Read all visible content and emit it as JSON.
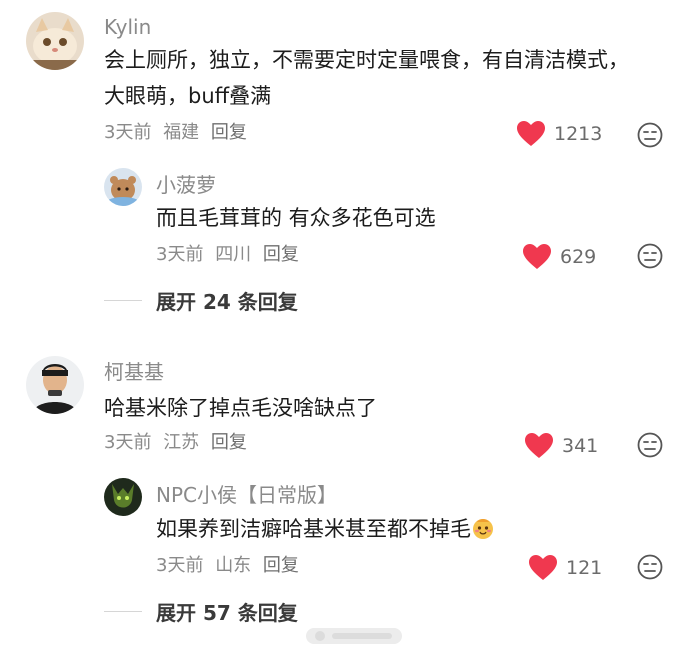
{
  "comments": [
    {
      "user": "Kylin",
      "text": "会上厕所，独立，不需要定时定量喂食，有自清洁模式，大眼萌，buff叠满",
      "time": "3天前",
      "location": "福建",
      "reply_label": "回复",
      "likes": "1213",
      "replies": [
        {
          "user": "小菠萝",
          "text": "而且毛茸茸的 有众多花色可选",
          "time": "3天前",
          "location": "四川",
          "reply_label": "回复",
          "likes": "629"
        }
      ],
      "expand_label": "展开 24 条回复"
    },
    {
      "user": "柯基基",
      "text": "哈基米除了掉点毛没啥缺点了",
      "time": "3天前",
      "location": "江苏",
      "reply_label": "回复",
      "likes": "341",
      "replies": [
        {
          "user": "NPC小侯【日常版】",
          "text": "如果养到洁癖哈基米甚至都不掉毛",
          "time": "3天前",
          "location": "山东",
          "reply_label": "回复",
          "likes": "121"
        }
      ],
      "expand_label": "展开 57 条回复"
    }
  ],
  "colors": {
    "like_heart": "#f0384f",
    "meta_gray": "#8a8a8a"
  },
  "icons": {
    "like": "heart-icon",
    "dislike": "meh-face-icon",
    "emoji": "smiling-face-emoji"
  }
}
